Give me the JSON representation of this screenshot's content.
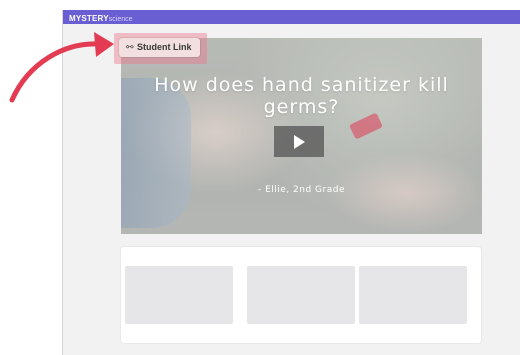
{
  "app": {
    "brand_bold": "MYSTERY",
    "brand_light": "science"
  },
  "hero": {
    "title": "How does hand sanitizer kill germs?",
    "credit": "- Ellie, 2nd Grade",
    "play_icon": "play-icon"
  },
  "student_link": {
    "icon": "link-icon",
    "label": "Student Link"
  },
  "colors": {
    "topbar": "#6a5fd2",
    "annotation_arrow": "#e23b52",
    "highlight": "#eb788c"
  }
}
